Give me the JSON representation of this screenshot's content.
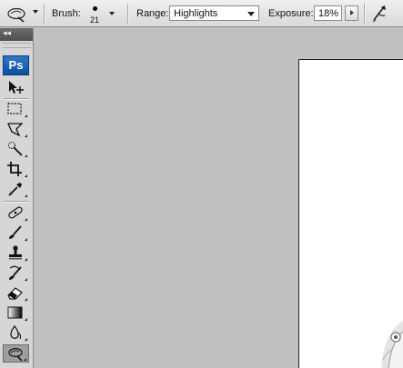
{
  "options_bar": {
    "tool_preset_icon": "dodge-tool-icon",
    "brush_label": "Brush:",
    "brush_size": "21",
    "range_label": "Range:",
    "range_value": "Highlights",
    "exposure_label": "Exposure:",
    "exposure_value": "18%",
    "airbrush_icon": "airbrush-icon"
  },
  "tools_panel": {
    "collapse_glyph": "◂◂",
    "logo_text": "Ps",
    "tools": [
      {
        "name": "move-tool",
        "icon": "move-icon"
      },
      {
        "name": "rectangular-marquee-tool",
        "icon": "marquee-icon"
      },
      {
        "name": "lasso-tool",
        "icon": "polygonal-lasso-icon"
      },
      {
        "name": "quick-selection-tool",
        "icon": "magic-wand-icon"
      },
      {
        "name": "crop-tool",
        "icon": "crop-icon"
      },
      {
        "name": "slice-tool",
        "icon": "eyedropper-icon"
      },
      {
        "name": "healing-brush-tool",
        "icon": "bandage-icon"
      },
      {
        "name": "brush-tool",
        "icon": "brush-icon"
      },
      {
        "name": "clone-stamp-tool",
        "icon": "stamp-icon"
      },
      {
        "name": "history-brush-tool",
        "icon": "history-brush-icon"
      },
      {
        "name": "eraser-tool",
        "icon": "eraser-icon"
      },
      {
        "name": "gradient-tool",
        "icon": "gradient-icon"
      },
      {
        "name": "blur-tool",
        "icon": "blur-icon"
      },
      {
        "name": "dodge-tool",
        "icon": "dodge-icon",
        "active": true
      }
    ]
  },
  "colors": {
    "workspace_bg": "#c0c0c0",
    "panel_bg": "#d6d6d6",
    "logo_blue": "#1f62b3",
    "canvas": "#ffffff"
  }
}
